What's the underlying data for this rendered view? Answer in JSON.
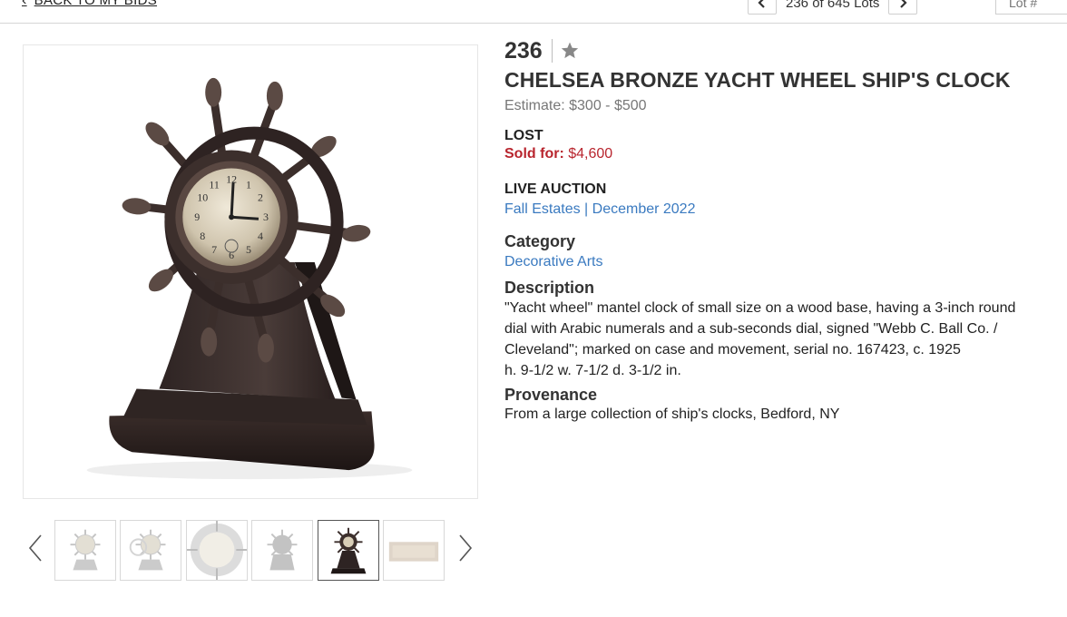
{
  "nav": {
    "back_label": "BACK TO MY BIDS",
    "lot_count": "236 of 645 Lots",
    "lot_input_placeholder": "Lot #"
  },
  "lot": {
    "number": "236",
    "title": "CHELSEA BRONZE YACHT WHEEL SHIP'S CLOCK",
    "estimate": "Estimate: $300 - $500",
    "status": "LOST",
    "sold_label": "Sold for:",
    "sold_value": "$4,600",
    "auction_type": "LIVE AUCTION",
    "auction_name": "Fall Estates | December 2022",
    "category_heading": "Category",
    "category": "Decorative Arts",
    "description_heading": "Description",
    "description": "\"Yacht wheel\" mantel clock of small size on a wood base, having a 3-inch round dial with Arabic numerals and a sub-seconds dial, signed \"Webb C. Ball Co. / Cleveland\"; marked on case and movement, serial no. 167423, c. 1925",
    "dimensions": "h. 9-1/2 w. 7-1/2 d. 3-1/2 in.",
    "provenance_heading": "Provenance",
    "provenance": "From a large collection of ship's clocks, Bedford, NY"
  },
  "gallery": {
    "thumbnail_count": 6,
    "active_index": 4
  },
  "colors": {
    "sold_red": "#b8252e",
    "link_blue": "#3a7ac0",
    "text_dark": "#333333",
    "muted": "#777777"
  },
  "icons": {
    "back": "chevron-left-icon",
    "prev_lot": "chevron-left-icon",
    "next_lot": "chevron-right-icon",
    "favorite": "star-icon",
    "thumb_prev": "chevron-left-icon",
    "thumb_next": "chevron-right-icon"
  }
}
